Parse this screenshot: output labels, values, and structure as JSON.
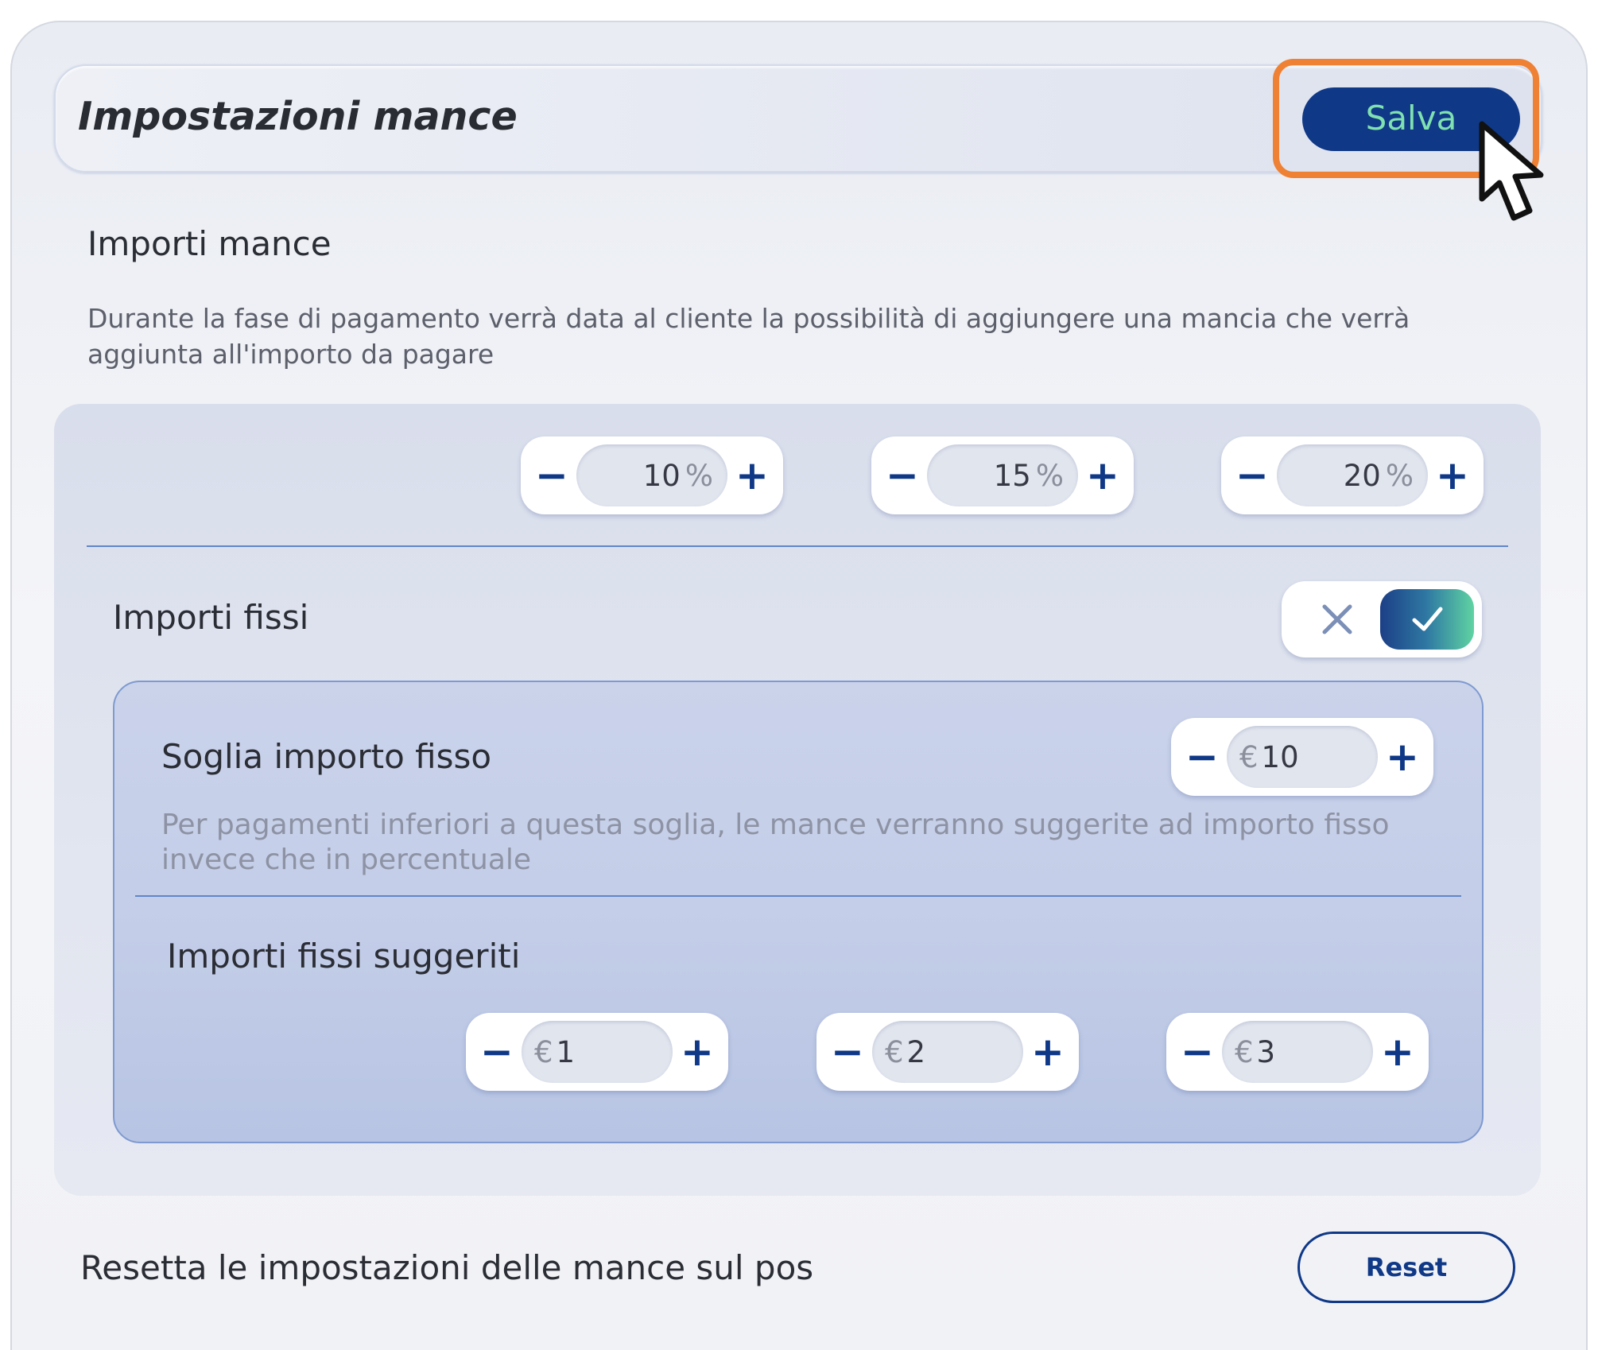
{
  "header": {
    "title": "Impostazioni mance",
    "save_label": "Salva"
  },
  "tips": {
    "title": "Importi mance",
    "description": "Durante la fase di pagamento verrà data al cliente la possibilità di aggiungere una mancia che verrà aggiunta all'importo da pagare",
    "percent_symbol": "%",
    "percentages": [
      {
        "value": "10"
      },
      {
        "value": "15"
      },
      {
        "value": "20"
      }
    ]
  },
  "fixed": {
    "title": "Importi fissi",
    "enabled": true,
    "currency_symbol": "€",
    "threshold": {
      "label": "Soglia importo fisso",
      "value": "10",
      "description": "Per pagamenti inferiori a questa soglia, le mance verranno suggerite ad importo fisso invece che in percentuale"
    },
    "suggested": {
      "title": "Importi fissi suggeriti",
      "amounts": [
        {
          "value": "1"
        },
        {
          "value": "2"
        },
        {
          "value": "3"
        }
      ]
    }
  },
  "controls": {
    "minus": "−",
    "plus": "+"
  },
  "reset": {
    "label": "Resetta le impostazioni delle mance sul pos",
    "button_label": "Reset"
  },
  "colors": {
    "primary": "#0f3887",
    "save_text": "#7fe0b0",
    "highlight": "#ee8133",
    "divider": "#5f86c8"
  },
  "icons": {
    "toggle_off": "close-icon",
    "toggle_on": "check-icon",
    "pointer": "mouse-pointer-icon"
  }
}
